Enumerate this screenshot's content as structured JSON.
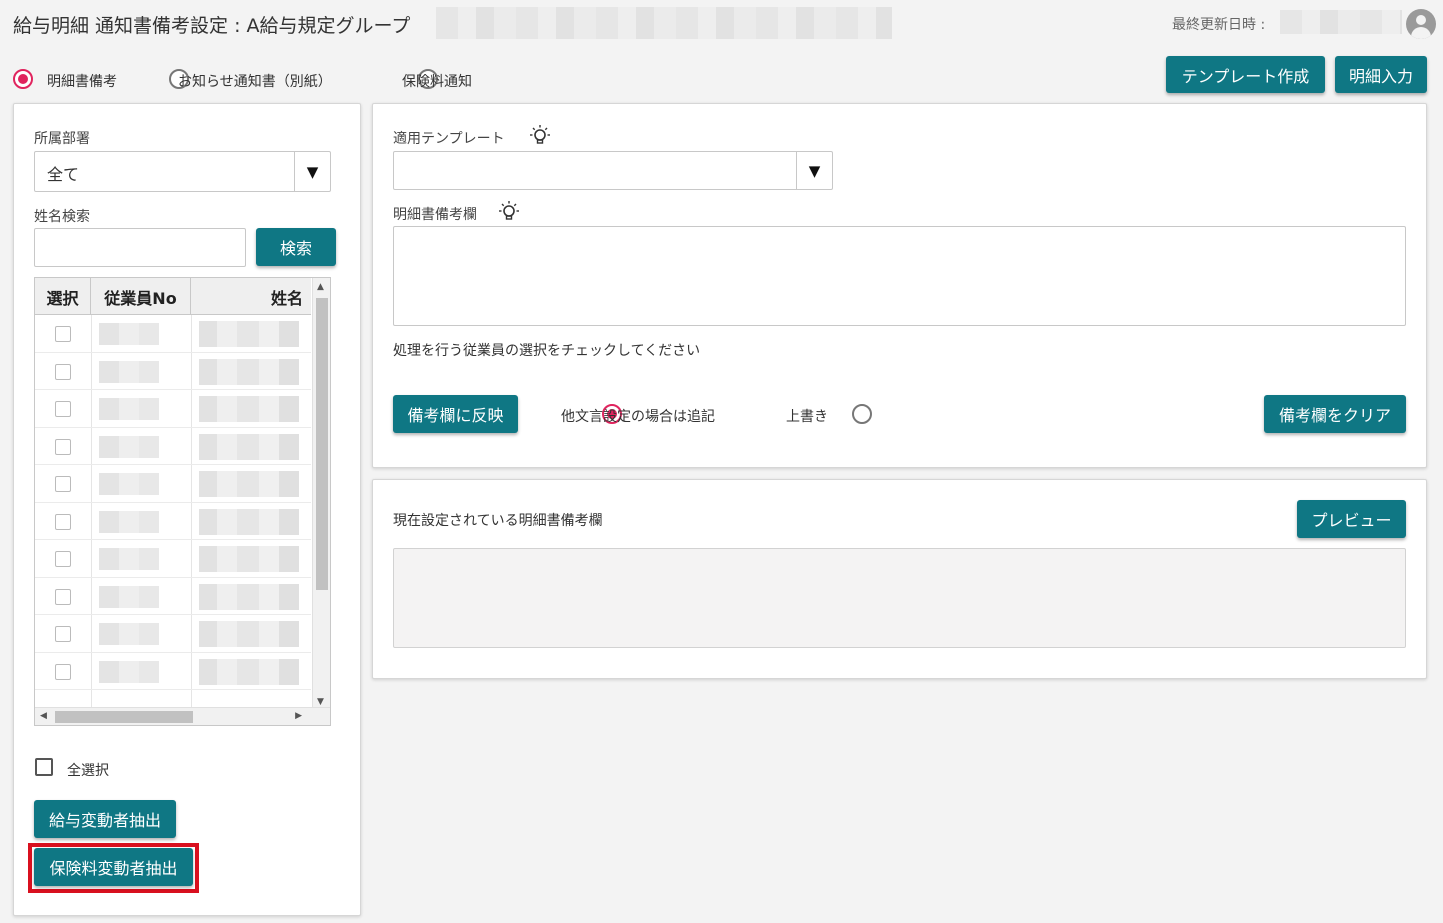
{
  "header": {
    "title": "給与明細 通知書備考設定 : A給与規定グループ",
    "last_updated_label": "最終更新日時 :"
  },
  "mode_options": [
    {
      "label": "明細書備考",
      "selected": true
    },
    {
      "label": "お知らせ通知書（別紙）",
      "selected": false
    },
    {
      "label": "保険料通知",
      "selected": false
    }
  ],
  "top_actions": {
    "template_create": "テンプレート作成",
    "detail_input": "明細入力"
  },
  "left_panel": {
    "department_label": "所属部署",
    "department_value": "全て",
    "dropdown_arrow": "▼",
    "name_search_label": "姓名検索",
    "name_search_value": "",
    "search_button": "検索",
    "table": {
      "columns": [
        "選択",
        "従業員No",
        "姓名"
      ],
      "row_count": 10
    },
    "select_all_label": "全選択",
    "salary_change_button": "給与変動者抽出",
    "insurance_change_button": "保険料変動者抽出"
  },
  "right_top_panel": {
    "template_label": "適用テンプレート",
    "template_value": "",
    "dropdown_arrow": "▼",
    "remarks_label": "明細書備考欄",
    "remarks_value": "",
    "instruction": "処理を行う従業員の選択をチェックしてください",
    "apply_button": "備考欄に反映",
    "apply_options": [
      {
        "label": "他文言設定の場合は追記",
        "selected": true
      },
      {
        "label": "上書き",
        "selected": false
      }
    ],
    "clear_button": "備考欄をクリア"
  },
  "right_bottom_panel": {
    "current_label": "現在設定されている明細書備考欄",
    "preview_button": "プレビュー",
    "current_value": ""
  },
  "colors": {
    "primary": "#0f7784",
    "radio_selected": "#e0245e",
    "highlight": "#d9101f"
  }
}
